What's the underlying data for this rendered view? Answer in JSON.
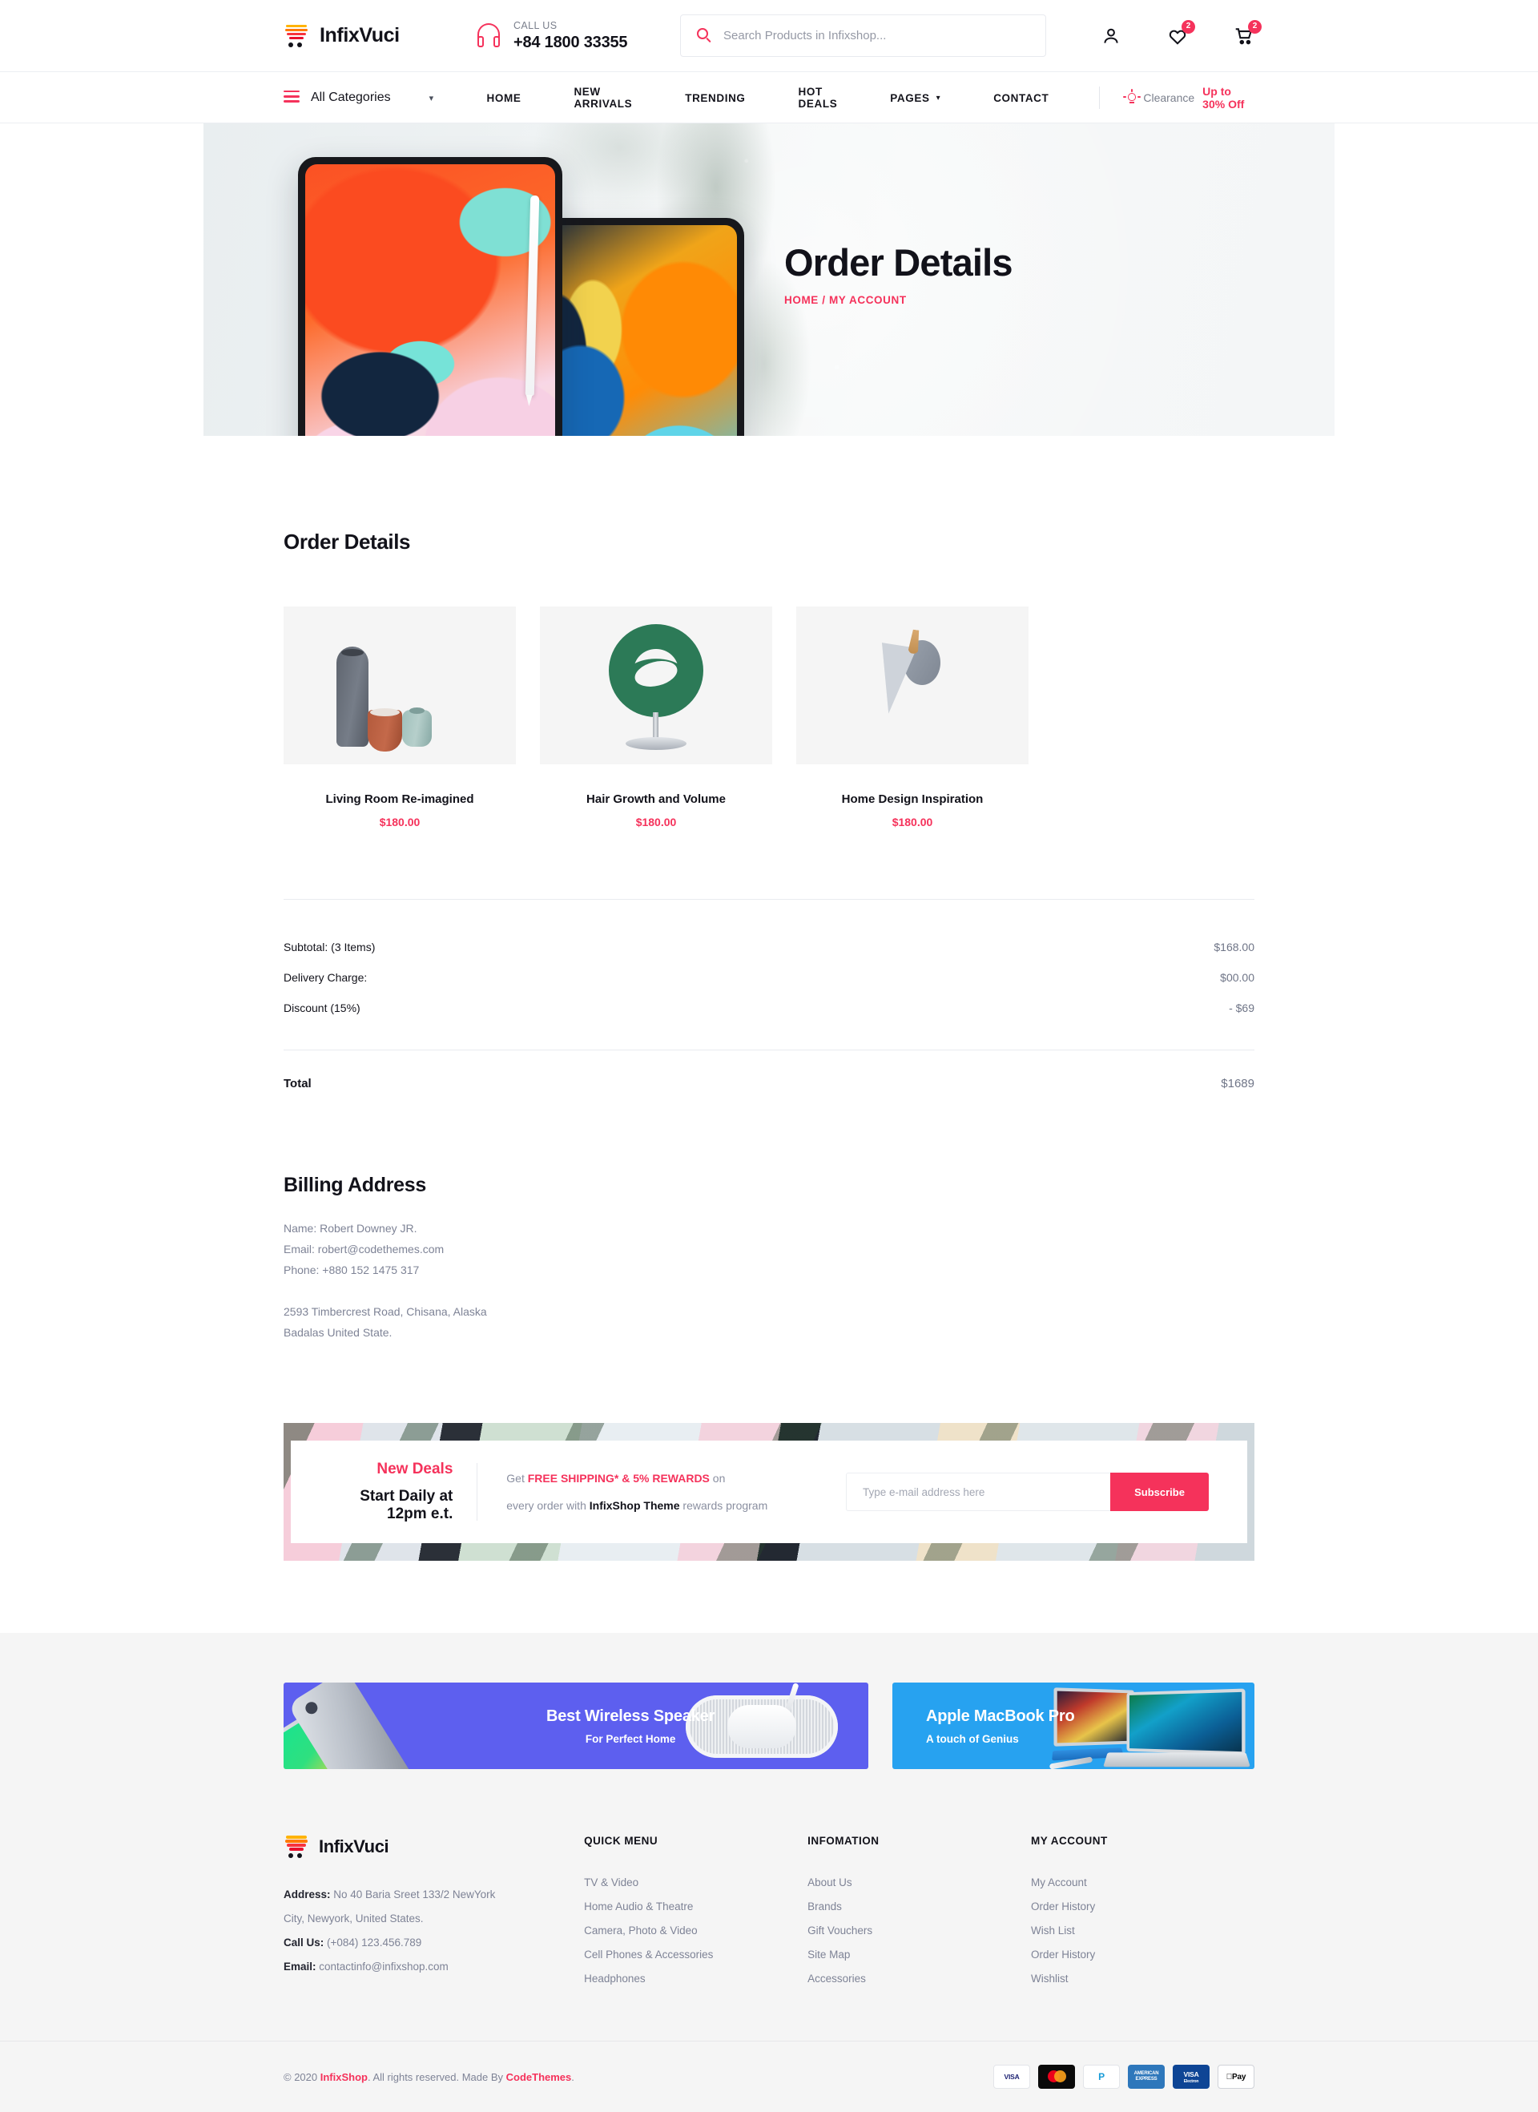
{
  "header": {
    "brand": "InfixVuci",
    "call_label": "CALL US",
    "call_number": "+84 1800 33355",
    "search_placeholder": "Search Products in Infixshop...",
    "wishlist_count": "2",
    "cart_count": "2"
  },
  "nav": {
    "all_categories": "All Categories",
    "links": [
      {
        "label": "HOME",
        "caret": ""
      },
      {
        "label": "NEW ARRIVALS",
        "caret": ""
      },
      {
        "label": "TRENDING",
        "caret": ""
      },
      {
        "label": "HOT DEALS",
        "caret": ""
      },
      {
        "label": "PAGES",
        "caret": "⌄"
      },
      {
        "label": "CONTACT",
        "caret": ""
      }
    ],
    "clearance_label": "Clearance",
    "clearance_offer": "Up to 30% Off"
  },
  "hero": {
    "title": "Order Details",
    "breadcrumb": "HOME / MY ACCOUNT"
  },
  "order": {
    "section_title": "Order Details",
    "products": [
      {
        "name": "Living Room Re-imagined",
        "price": "$180.00"
      },
      {
        "name": "Hair Growth and Volume",
        "price": "$180.00"
      },
      {
        "name": "Home Design Inspiration",
        "price": "$180.00"
      }
    ],
    "summary": [
      {
        "key": "Subtotal: (3 Items)",
        "value": "$168.00"
      },
      {
        "key": "Delivery Charge:",
        "value": "$00.00"
      },
      {
        "key": "Discount (15%)",
        "value": "- $69"
      }
    ],
    "total_key": "Total",
    "total_value": "$1689"
  },
  "billing": {
    "title": "Billing Address",
    "name": "Name: Robert Downey JR.",
    "email": "Email: robert@codethemes.com",
    "phone": "Phone: +880 152 1475 317",
    "address_line1": "2593 Timbercrest Road, Chisana, Alaska",
    "address_line2": "Badalas United State."
  },
  "newsletter": {
    "deal_title": "New Deals",
    "deal_sub": "Start Daily at 12pm e.t.",
    "line1_pre": "Get ",
    "line1_bold": "FREE SHIPPING* & 5% REWARDS",
    "line1_post": " on",
    "line2_pre": "every order with ",
    "line2_bold": "InfixShop Theme",
    "line2_post": " rewards program",
    "input_placeholder": "Type e-mail  address here",
    "button": "Subscribe"
  },
  "promos": [
    {
      "title": "Best Wireless Speaker",
      "subtitle": "For Perfect Home"
    },
    {
      "title": "Apple MacBook Pro",
      "subtitle": "A touch of Genius"
    }
  ],
  "footer": {
    "brand": "InfixVuci",
    "address_label": "Address:",
    "address_value": " No 40 Baria Sreet 133/2 NewYork",
    "address_line2": "City, Newyork, United States.",
    "call_label": "Call Us:",
    "call_value": " (+084) 123.456.789",
    "email_label": "Email:",
    "email_value": " contactinfo@infixshop.com",
    "columns": [
      {
        "heading": "QUICK MENU",
        "items": [
          "TV & Video",
          "Home Audio & Theatre",
          "Camera, Photo & Video",
          "Cell Phones & Accessories",
          "Headphones"
        ]
      },
      {
        "heading": "INFOMATION",
        "items": [
          "About Us",
          "Brands",
          "Gift Vouchers",
          "Site Map",
          "Accessories"
        ]
      },
      {
        "heading": "MY ACCOUNT",
        "items": [
          "My Account",
          "Order History",
          "Wish List",
          "Order History",
          "Wishlist"
        ]
      }
    ],
    "copyright_pre": "© 2020 ",
    "copyright_brand": "InfixShop",
    "copyright_mid": ". All rights reserved. Made By ",
    "copyright_author": "CodeThemes",
    "copyright_end": ".",
    "payments": [
      "VISA",
      "mastercard",
      "PayPal",
      "AMERICAN EXPRESS",
      "VISA Electron",
      "Apple Pay"
    ]
  }
}
